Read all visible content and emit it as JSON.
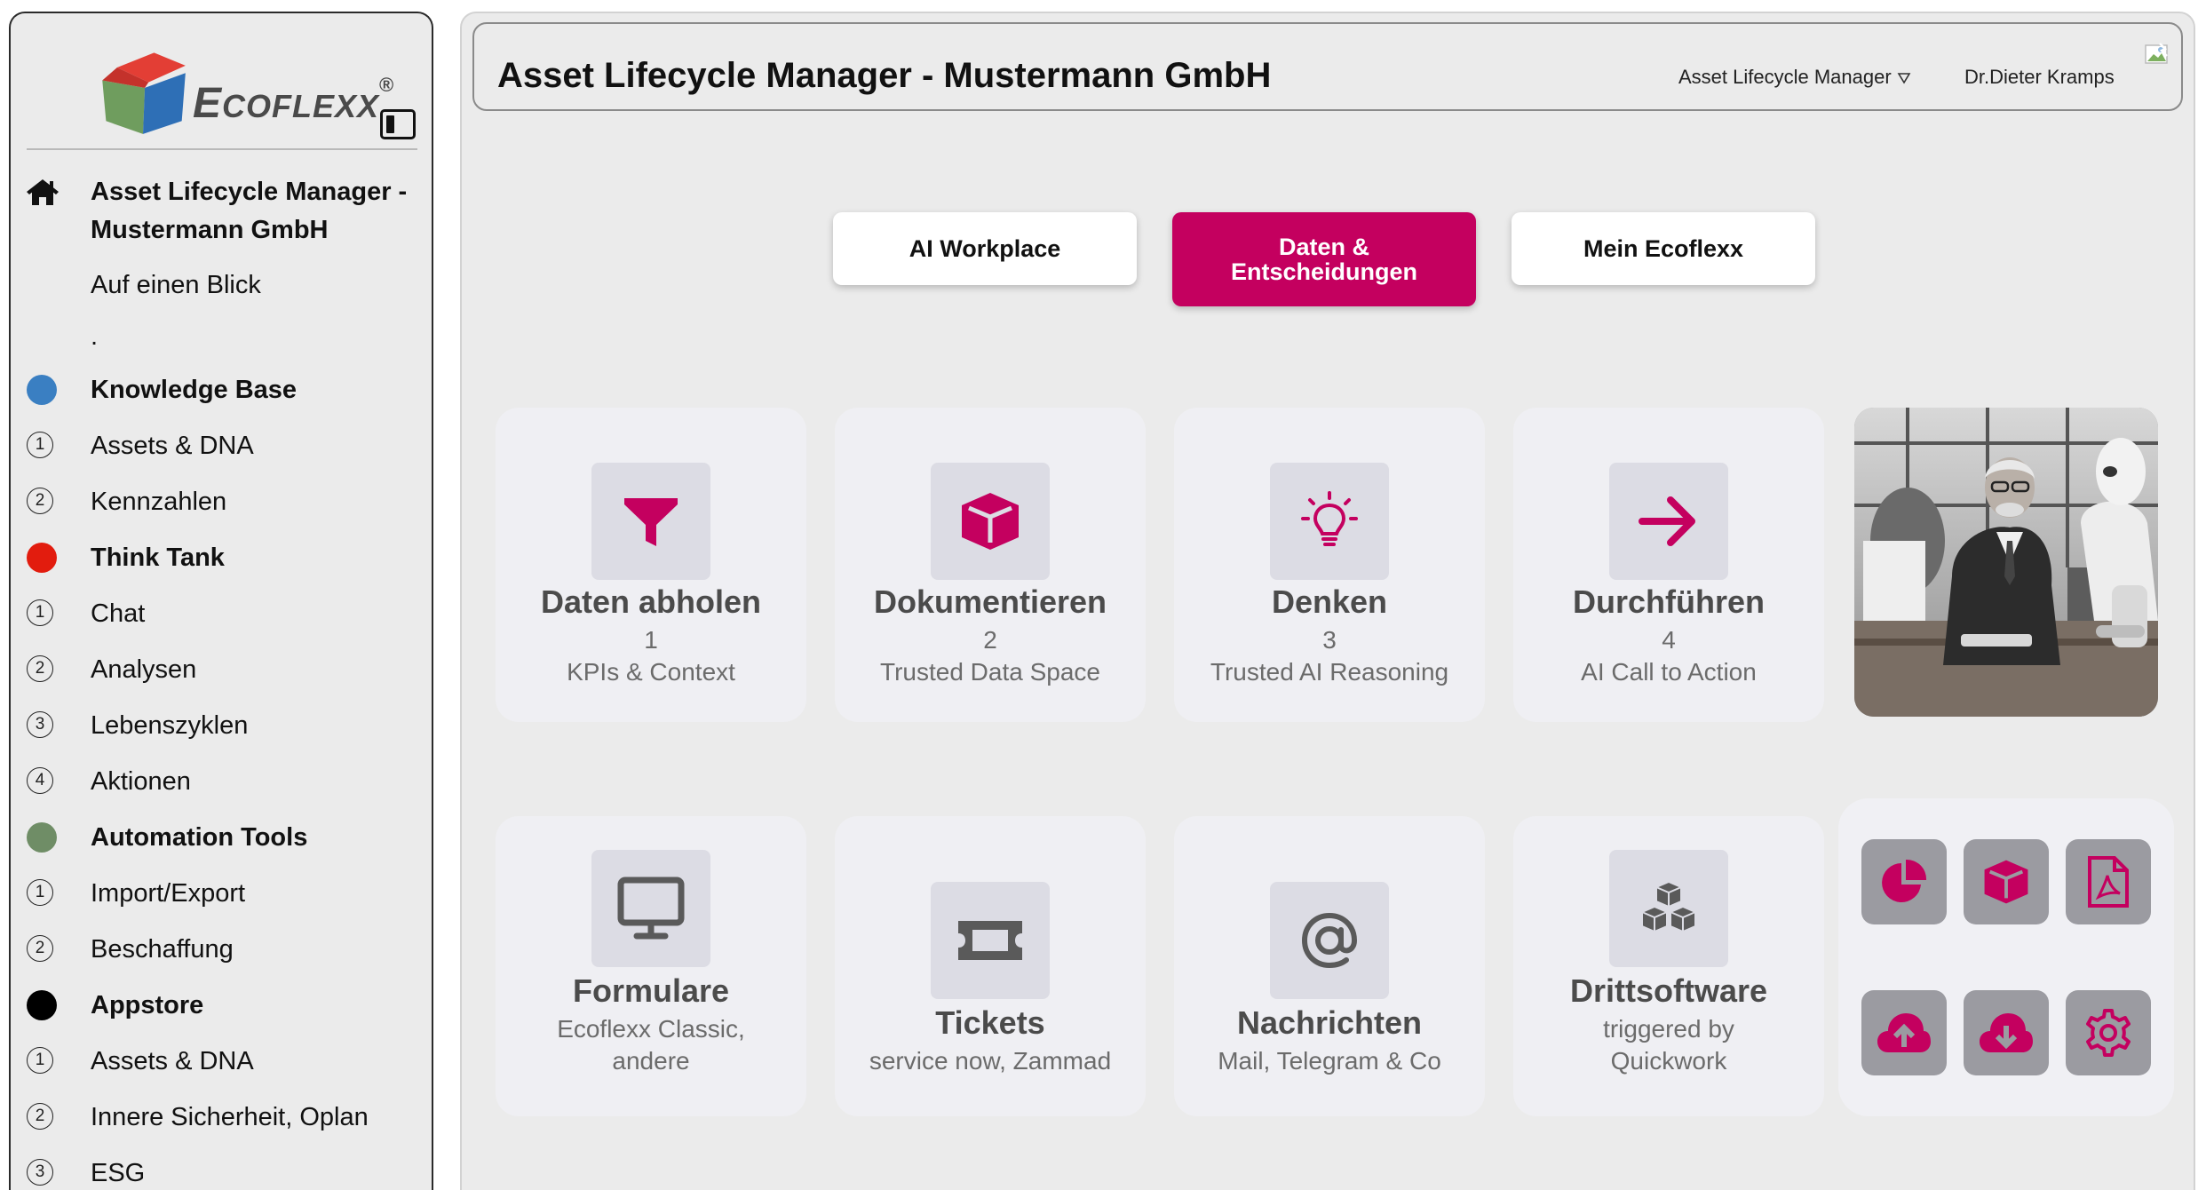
{
  "sidebar": {
    "logo_first_letter": "E",
    "logo_rest": "COFLEXX",
    "logo_mark": "®",
    "home_label": "Asset Lifecycle Manager - Mustermann GmbH",
    "overview_label": "Auf einen Blick",
    "dot_item": ".",
    "items": [
      {
        "type": "section",
        "label": "Knowledge Base",
        "color": "#3a7fc2"
      },
      {
        "type": "item",
        "num": "1",
        "label": "Assets & DNA"
      },
      {
        "type": "item",
        "num": "2",
        "label": "Kennzahlen"
      },
      {
        "type": "section",
        "label": "Think Tank",
        "color": "#e21c0e"
      },
      {
        "type": "item",
        "num": "1",
        "label": "Chat"
      },
      {
        "type": "item",
        "num": "2",
        "label": "Analysen"
      },
      {
        "type": "item",
        "num": "3",
        "label": "Lebenszyklen"
      },
      {
        "type": "item",
        "num": "4",
        "label": "Aktionen"
      },
      {
        "type": "section",
        "label": "Automation Tools",
        "color": "#6f8d66"
      },
      {
        "type": "item",
        "num": "1",
        "label": "Import/Export"
      },
      {
        "type": "item",
        "num": "2",
        "label": "Beschaffung"
      },
      {
        "type": "section",
        "label": "Appstore",
        "color": "#000000"
      },
      {
        "type": "item",
        "num": "1",
        "label": "Assets & DNA"
      },
      {
        "type": "item",
        "num": "2",
        "label": "Innere Sicherheit, Oplan"
      },
      {
        "type": "item",
        "num": "3",
        "label": "ESG"
      }
    ]
  },
  "header": {
    "title": "Asset Lifecycle Manager - Mustermann GmbH",
    "app_switch": "Asset Lifecycle Manager",
    "user": "Dr.Dieter Kramps"
  },
  "tabs": [
    {
      "label": "AI Workplace",
      "active": false
    },
    {
      "label": "Daten & Entscheidungen",
      "active": true
    },
    {
      "label": "Mein Ecoflexx",
      "active": false
    }
  ],
  "steps": [
    {
      "title": "Daten abholen",
      "num": "1",
      "sub": "KPIs & Context",
      "icon": "filter-icon"
    },
    {
      "title": "Dokumentieren",
      "num": "2",
      "sub": "Trusted Data Space",
      "icon": "cube-icon"
    },
    {
      "title": "Denken",
      "num": "3",
      "sub": "Trusted AI Reasoning",
      "icon": "lightbulb-icon"
    },
    {
      "title": "Durchführen",
      "num": "4",
      "sub": "AI Call to Action",
      "icon": "arrow-right-icon"
    }
  ],
  "integrations": [
    {
      "title": "Formulare",
      "sub1": "Ecoflexx Classic,",
      "sub2": "andere",
      "icon": "monitor-icon"
    },
    {
      "title": "Tickets",
      "sub1": "service now, Zammad",
      "icon": "ticket-icon"
    },
    {
      "title": "Nachrichten",
      "sub1": "Mail, Telegram & Co",
      "icon": "at-sign-icon"
    },
    {
      "title": "Drittsoftware",
      "sub1": "triggered by",
      "sub2": "Quickwork",
      "icon": "cubes-icon"
    }
  ],
  "quick_icons": [
    "pie-chart-icon",
    "cube-icon",
    "pdf-file-icon",
    "cloud-upload-icon",
    "cloud-download-icon",
    "gear-icon"
  ],
  "colors": {
    "accent": "#c4005f",
    "icon_gray": "#5a5a5a",
    "card_bg": "#efeff3",
    "quick_btn": "#9b9ba1"
  }
}
